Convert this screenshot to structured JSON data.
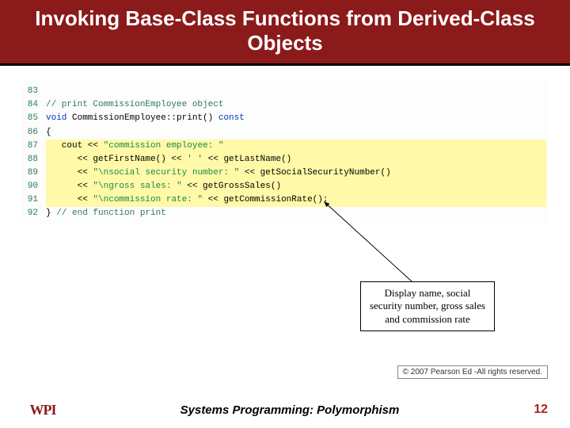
{
  "title": "Invoking Base-Class Functions from Derived-Class Objects",
  "code": {
    "lines": [
      {
        "n": "83",
        "hl": false,
        "html": ""
      },
      {
        "n": "84",
        "hl": false,
        "html": "<span class='cmt'>// print CommissionEmployee object</span>"
      },
      {
        "n": "85",
        "hl": false,
        "html": "<span class='kw'>void</span> CommissionEmployee::print() <span class='kw'>const</span>"
      },
      {
        "n": "86",
        "hl": false,
        "html": "{"
      },
      {
        "n": "87",
        "hl": true,
        "html": "   cout &lt;&lt; <span class='str'>\"commission employee: \"</span>"
      },
      {
        "n": "88",
        "hl": true,
        "html": "      &lt;&lt; getFirstName() &lt;&lt; <span class='str'>' '</span> &lt;&lt; getLastName()"
      },
      {
        "n": "89",
        "hl": true,
        "html": "      &lt;&lt; <span class='str'>\"\\nsocial security number: \"</span> &lt;&lt; getSocialSecurityNumber()"
      },
      {
        "n": "90",
        "hl": true,
        "html": "      &lt;&lt; <span class='str'>\"\\ngross sales: \"</span> &lt;&lt; getGrossSales()"
      },
      {
        "n": "91",
        "hl": true,
        "html": "      &lt;&lt; <span class='str'>\"\\ncommission rate: \"</span> &lt;&lt; getCommissionRate();"
      },
      {
        "n": "92",
        "hl": false,
        "html": "} <span class='cmt'>// end function print</span>"
      }
    ]
  },
  "callout": "Display name, social security number, gross sales and commission rate",
  "copyright": "© 2007 Pearson Ed -All rights reserved.",
  "footer": {
    "logo": "WPI",
    "title": "Systems Programming:  Polymorphism",
    "page": "12"
  }
}
